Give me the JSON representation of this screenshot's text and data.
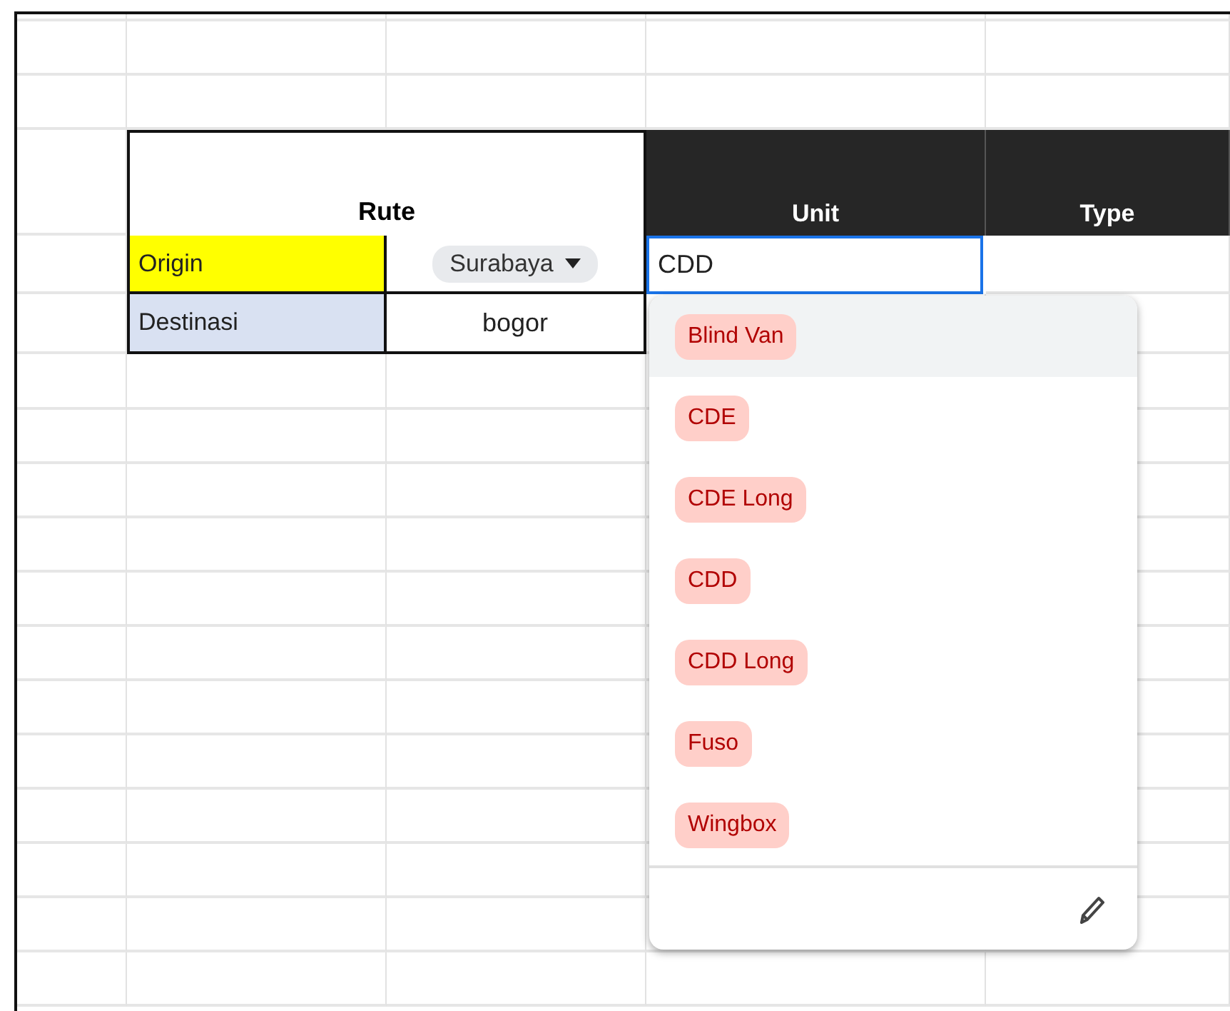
{
  "sheet": {
    "group_header": "Rute",
    "columns": [
      {
        "label": "Unit"
      },
      {
        "label": "Type"
      }
    ],
    "rows": [
      {
        "label": "Origin",
        "color": "#ffff00",
        "value": "Surabaya",
        "kind": "dropdown"
      },
      {
        "label": "Destinasi",
        "color": "#d9e1f2",
        "value": "bogor",
        "kind": "text"
      }
    ],
    "unit_editor": {
      "value": "CDD"
    }
  },
  "dropdown": {
    "options": [
      {
        "label": "Blind Van",
        "selected": true
      },
      {
        "label": "CDE",
        "selected": false
      },
      {
        "label": "CDE Long",
        "selected": false
      },
      {
        "label": "CDD",
        "selected": false
      },
      {
        "label": "CDD Long",
        "selected": false
      },
      {
        "label": "Fuso",
        "selected": false
      },
      {
        "label": "Wingbox",
        "selected": false
      }
    ]
  }
}
